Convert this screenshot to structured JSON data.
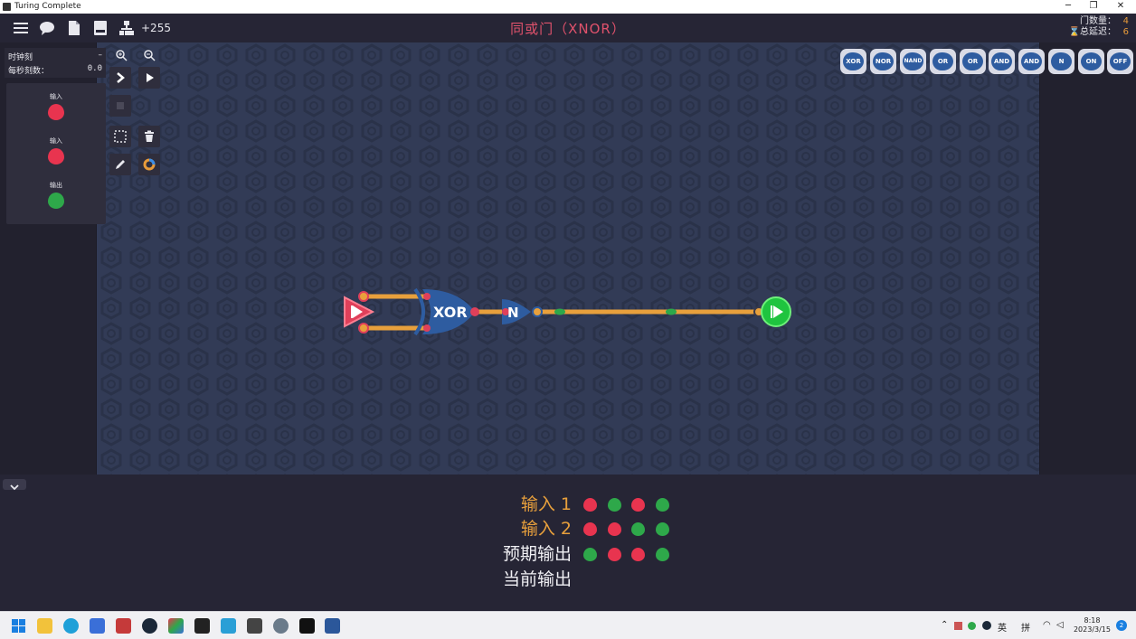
{
  "window": {
    "title": "Turing Complete",
    "minimize": "─",
    "restore": "❐",
    "close": "✕"
  },
  "topbar": {
    "icons": [
      "menu-icon",
      "chat-icon",
      "document-icon",
      "save-icon",
      "hierarchy-icon"
    ],
    "component_count": "+255",
    "level_title": "同或门（XNOR）",
    "gate_count_label": "门数量：",
    "gate_count_value": "4",
    "total_delay_label": "总延迟：",
    "total_delay_value": "6"
  },
  "clock_panel": {
    "tick_label": "时钟刻",
    "tick_value": "–",
    "tps_label": "每秒刻数：",
    "tps_value": "0.0"
  },
  "io_panel": {
    "items": [
      {
        "label": "输入",
        "color": "#e8344f"
      },
      {
        "label": "输入",
        "color": "#e8344f"
      },
      {
        "label": "输出",
        "color": "#2ea84a"
      }
    ]
  },
  "tools": [
    "zoom-in-icon",
    "zoom-out-icon",
    "step-icon",
    "play-icon",
    "stop-icon",
    "select-icon",
    "delete-icon",
    "pencil-icon",
    "color-wheel-icon"
  ],
  "palette": {
    "gates": [
      "XOR",
      "NOR",
      "NAND",
      "OR",
      "OR",
      "AND",
      "AND",
      "N",
      "ON",
      "OFF"
    ]
  },
  "circuit": {
    "xor_label": "XOR",
    "not_label": "N"
  },
  "truth_table": {
    "rows": [
      {
        "label": "输入 1",
        "color": "#e8a03c",
        "values": [
          0,
          1,
          0,
          1
        ]
      },
      {
        "label": "输入 2",
        "color": "#e8a03c",
        "values": [
          0,
          0,
          1,
          1
        ]
      },
      {
        "label": "预期输出",
        "color": "#f0f0f4",
        "values": [
          1,
          0,
          0,
          1
        ]
      },
      {
        "label": "当前输出",
        "color": "#f0f0f4",
        "values": []
      }
    ],
    "on_color": "#2ea84a",
    "off_color": "#e8344f"
  },
  "taskbar": {
    "tray_lang": "英",
    "tray_ime": "拼",
    "time": "8:18",
    "date": "2023/3/15",
    "notification_count": "2"
  }
}
